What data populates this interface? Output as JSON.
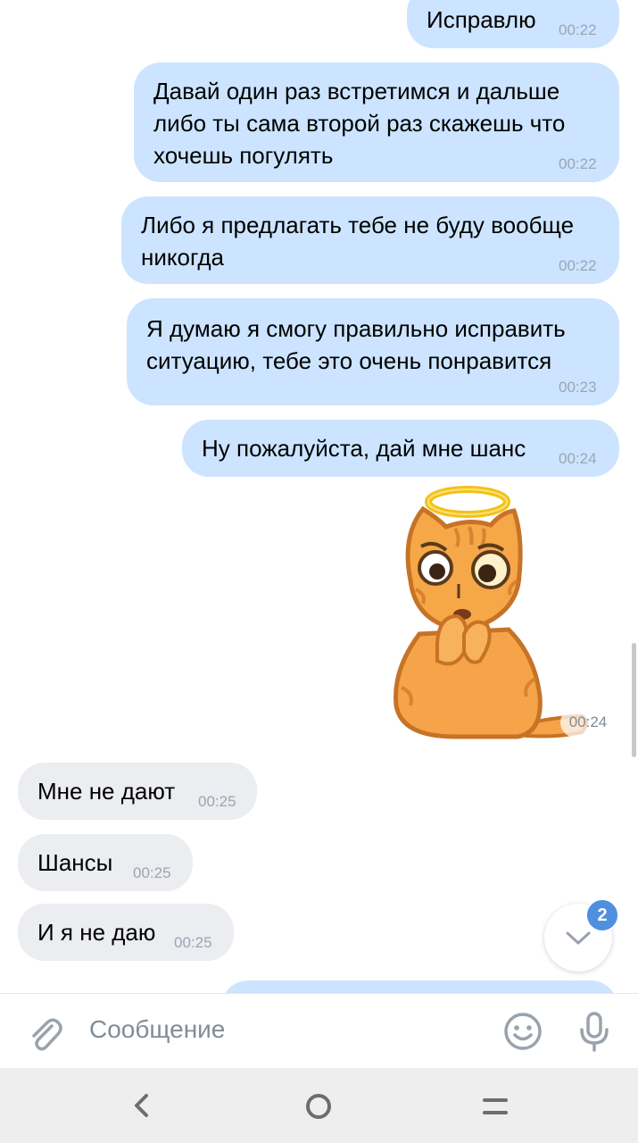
{
  "messages": [
    {
      "direction": "out",
      "text": "Исправлю",
      "time": "00:22"
    },
    {
      "direction": "out",
      "text": "Давай один раз встретимся и дальше\nлибо ты сама второй раз скажешь что\nхочешь погулять",
      "time": "00:22"
    },
    {
      "direction": "out",
      "text": "Либо я предлагать тебе не буду вообще\nникогда",
      "time": "00:22"
    },
    {
      "direction": "out",
      "text": "Я думаю я смогу правильно исправить\nситуацию, тебе это очень понравится",
      "time": "00:23"
    },
    {
      "direction": "out",
      "text": "Ну пожалуйста, дай мне шанс",
      "time": "00:24"
    },
    {
      "direction": "out",
      "type": "sticker",
      "sticker": "praying-cat-with-halo",
      "time": "00:24"
    },
    {
      "direction": "in",
      "text": "Мне не дают",
      "time": "00:25"
    },
    {
      "direction": "in",
      "text": "Шансы",
      "time": "00:25"
    },
    {
      "direction": "in",
      "text": "И я не даю",
      "time": "00:25"
    }
  ],
  "scroll_down": {
    "unread_count": "2",
    "icon": "chevron-down-icon"
  },
  "composer": {
    "placeholder": "Сообщение",
    "attach_icon": "paperclip-icon",
    "emoji_icon": "smile-icon",
    "voice_icon": "microphone-icon"
  },
  "navbar": {
    "icons": [
      "back-icon",
      "home-icon",
      "recents-icon"
    ]
  },
  "colors": {
    "outgoing_bubble": "#cce4ff",
    "incoming_bubble": "#ebedf0",
    "time_text": "#9aa6b3",
    "badge": "#4f8fe0",
    "icon": "#99a2ad"
  }
}
